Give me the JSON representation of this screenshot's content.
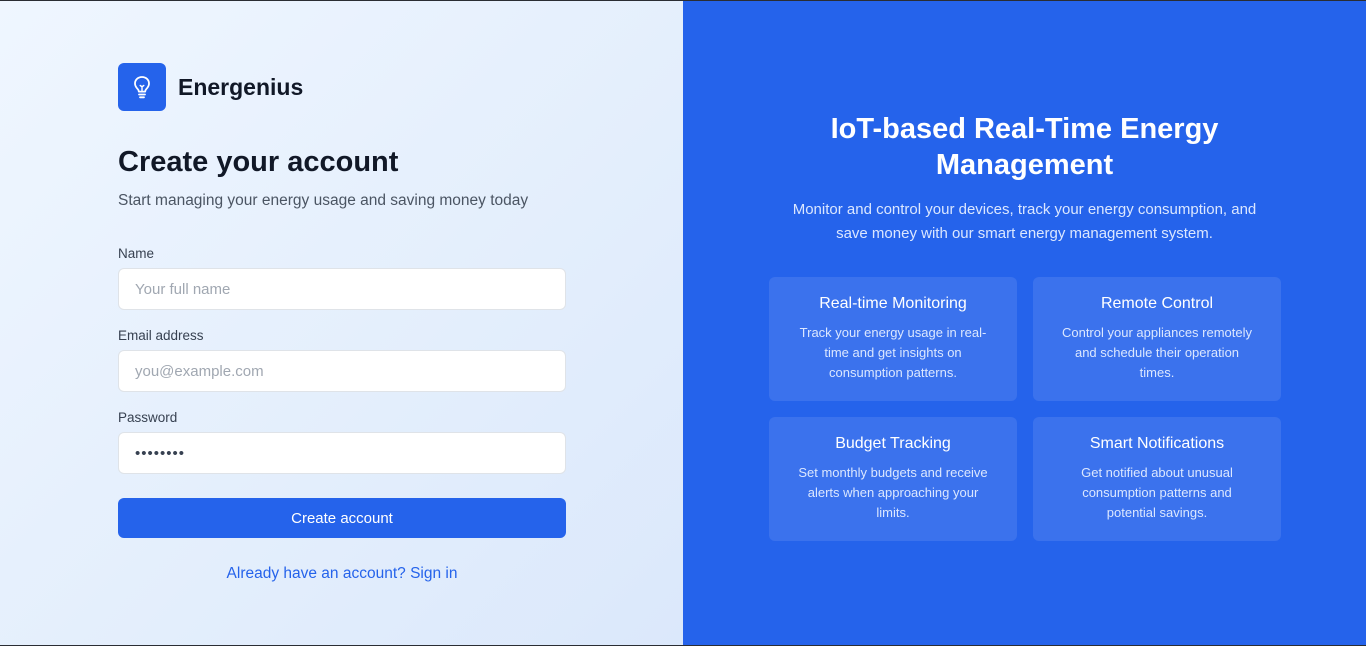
{
  "brand": {
    "name": "Energenius",
    "logo_icon": "lightbulb-icon",
    "color": "#2563eb"
  },
  "form": {
    "title": "Create your account",
    "subtitle": "Start managing your energy usage and saving money today",
    "fields": {
      "name": {
        "label": "Name",
        "placeholder": "Your full name",
        "value": ""
      },
      "email": {
        "label": "Email address",
        "placeholder": "you@example.com",
        "value": ""
      },
      "password": {
        "label": "Password",
        "value_masked": "••••••••"
      }
    },
    "submit_label": "Create account",
    "signin_link": "Already have an account? Sign in"
  },
  "hero": {
    "title_line1": "IoT-based Real-Time Energy",
    "title_line2": "Management",
    "subtitle_line1": "Monitor and control your devices, track your energy consumption, and",
    "subtitle_line2": "save money with our smart energy management system.",
    "features": [
      {
        "title": "Real-time Monitoring",
        "desc": [
          "Track your energy usage in real-",
          "time and get insights on",
          "consumption patterns."
        ]
      },
      {
        "title": "Remote Control",
        "desc": [
          "Control your appliances remotely",
          "and schedule their operation",
          "times."
        ]
      },
      {
        "title": "Budget Tracking",
        "desc": [
          "Set monthly budgets and receive",
          "alerts when approaching your",
          "limits."
        ]
      },
      {
        "title": "Smart Notifications",
        "desc": [
          "Get notified about unusual",
          "consumption patterns and",
          "potential savings."
        ]
      }
    ]
  },
  "colors": {
    "accent": "#2563eb",
    "left_bg": "#e8f0fd"
  }
}
